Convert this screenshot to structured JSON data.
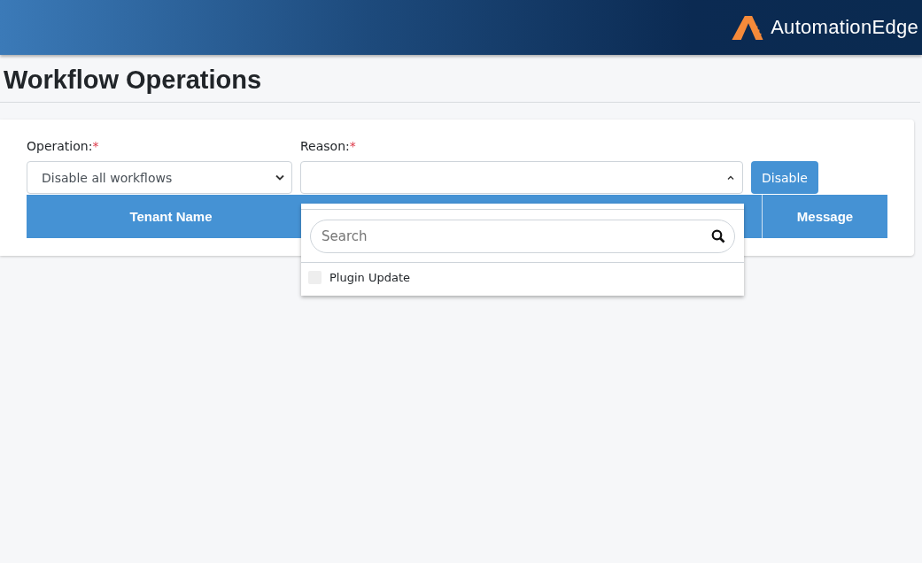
{
  "brand": {
    "name": "AutomationEdge"
  },
  "page_title": "Workflow Operations",
  "form": {
    "operation": {
      "label": "Operation:",
      "required_mark": "*",
      "value": "Disable all workflows"
    },
    "reason": {
      "label": "Reason:",
      "required_mark": "*",
      "expanded": true,
      "search_placeholder": "Search",
      "options": [
        {
          "label": "Plugin Update",
          "checked": false
        }
      ]
    },
    "action_button": "Disable"
  },
  "table": {
    "columns": [
      "Tenant Name",
      "Message"
    ]
  }
}
